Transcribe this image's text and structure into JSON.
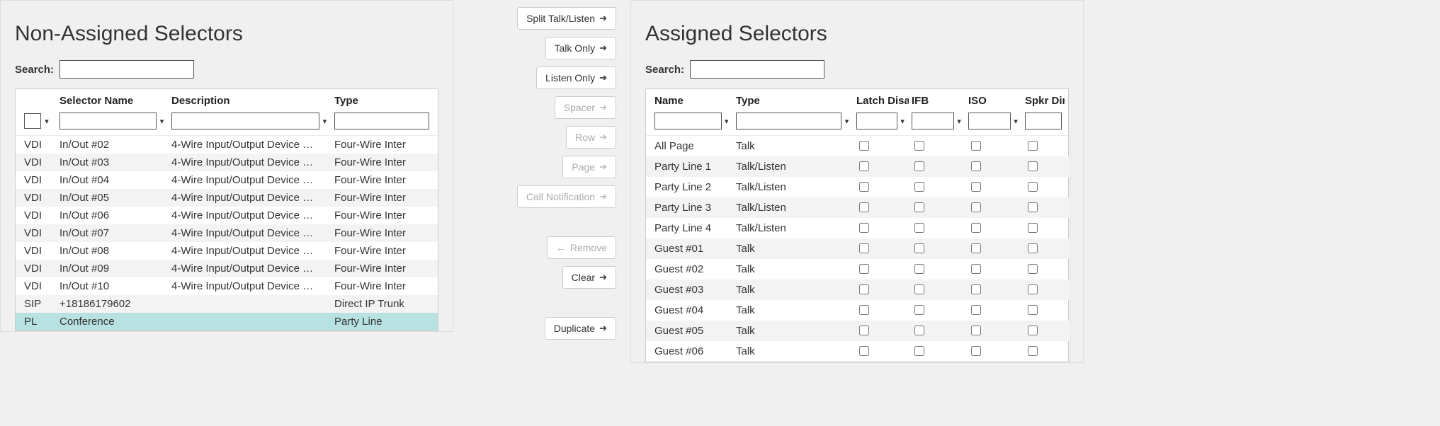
{
  "left": {
    "title": "Non-Assigned Selectors",
    "search_label": "Search:",
    "headers": {
      "name": "Selector Name",
      "desc": "Description",
      "type": "Type"
    },
    "rows": [
      {
        "pfx": "VDI",
        "name": "In/Out #02",
        "desc": "4-Wire Input/Output Device …",
        "type": "Four-Wire Inter"
      },
      {
        "pfx": "VDI",
        "name": "In/Out #03",
        "desc": "4-Wire Input/Output Device …",
        "type": "Four-Wire Inter"
      },
      {
        "pfx": "VDI",
        "name": "In/Out #04",
        "desc": "4-Wire Input/Output Device …",
        "type": "Four-Wire Inter"
      },
      {
        "pfx": "VDI",
        "name": "In/Out #05",
        "desc": "4-Wire Input/Output Device …",
        "type": "Four-Wire Inter"
      },
      {
        "pfx": "VDI",
        "name": "In/Out #06",
        "desc": "4-Wire Input/Output Device …",
        "type": "Four-Wire Inter"
      },
      {
        "pfx": "VDI",
        "name": "In/Out #07",
        "desc": "4-Wire Input/Output Device …",
        "type": "Four-Wire Inter"
      },
      {
        "pfx": "VDI",
        "name": "In/Out #08",
        "desc": "4-Wire Input/Output Device …",
        "type": "Four-Wire Inter"
      },
      {
        "pfx": "VDI",
        "name": "In/Out #09",
        "desc": "4-Wire Input/Output Device …",
        "type": "Four-Wire Inter"
      },
      {
        "pfx": "VDI",
        "name": "In/Out #10",
        "desc": "4-Wire Input/Output Device …",
        "type": "Four-Wire Inter"
      },
      {
        "pfx": "SIP",
        "name": "+18186179602",
        "desc": "",
        "type": "Direct IP Trunk"
      },
      {
        "pfx": "PL",
        "name": "Conference",
        "desc": "",
        "type": "Party Line",
        "selected": true
      }
    ]
  },
  "buttons": {
    "split": "Split Talk/Listen",
    "talk": "Talk Only",
    "listen": "Listen Only",
    "spacer": "Spacer",
    "row": "Row",
    "page": "Page",
    "call": "Call Notification",
    "remove": "Remove",
    "clear": "Clear",
    "duplicate": "Duplicate"
  },
  "right": {
    "title": "Assigned Selectors",
    "search_label": "Search:",
    "headers": {
      "name": "Name",
      "type": "Type",
      "latch": "Latch Disable",
      "ifb": "IFB",
      "iso": "ISO",
      "spkr": "Spkr Dim"
    },
    "rows": [
      {
        "name": "All Page",
        "type": "Talk"
      },
      {
        "name": "Party Line 1",
        "type": "Talk/Listen"
      },
      {
        "name": "Party Line 2",
        "type": "Talk/Listen"
      },
      {
        "name": "Party Line 3",
        "type": "Talk/Listen"
      },
      {
        "name": "Party Line 4",
        "type": "Talk/Listen"
      },
      {
        "name": "Guest #01",
        "type": "Talk"
      },
      {
        "name": "Guest #02",
        "type": "Talk"
      },
      {
        "name": "Guest #03",
        "type": "Talk"
      },
      {
        "name": "Guest #04",
        "type": "Talk"
      },
      {
        "name": "Guest #05",
        "type": "Talk"
      },
      {
        "name": "Guest #06",
        "type": "Talk"
      }
    ]
  }
}
